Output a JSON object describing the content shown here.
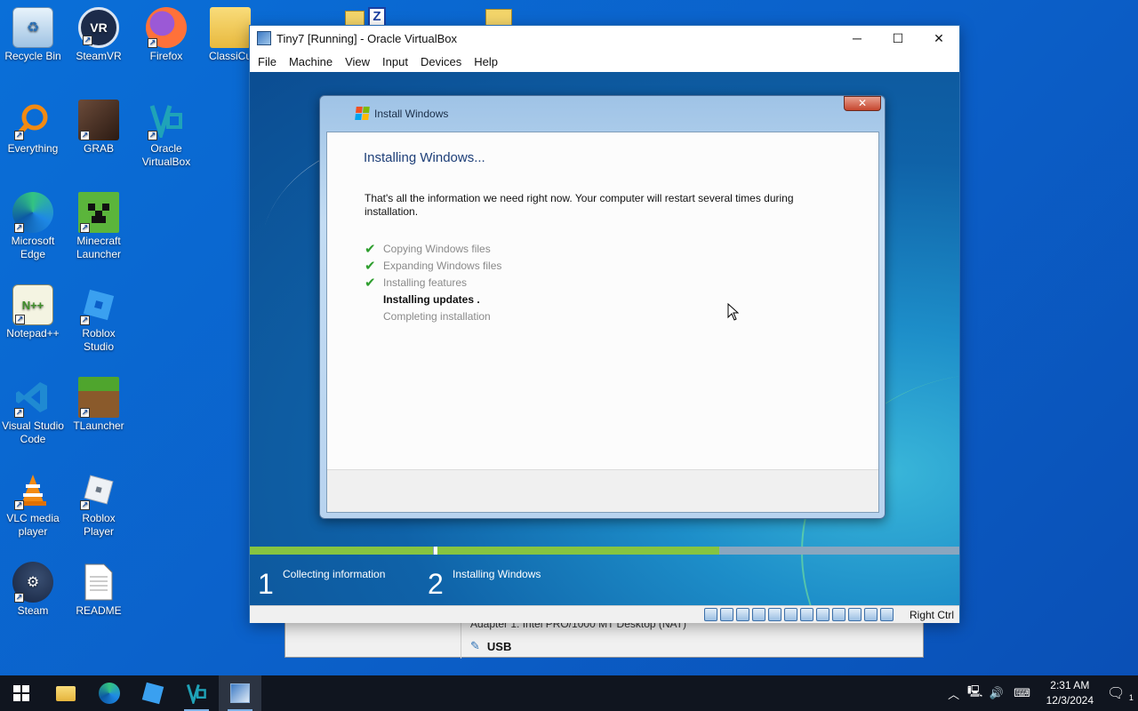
{
  "desktop_icons": [
    {
      "label": "Recycle Bin",
      "icon": "recycle-bin-icon"
    },
    {
      "label": "SteamVR",
      "icon": "steamvr-icon"
    },
    {
      "label": "Firefox",
      "icon": "firefox-icon"
    },
    {
      "label": "ClassiCu",
      "icon": "folder-icon"
    },
    {
      "label": "Everything",
      "icon": "everything-icon"
    },
    {
      "label": "GRAB",
      "icon": "grab-icon"
    },
    {
      "label": "Oracle VirtualBox",
      "icon": "virtualbox-icon"
    },
    {
      "label": "Microsoft Edge",
      "icon": "edge-icon"
    },
    {
      "label": "Minecraft Launcher",
      "icon": "minecraft-icon"
    },
    {
      "label": "Notepad++",
      "icon": "notepad-plus-plus-icon"
    },
    {
      "label": "Roblox Studio",
      "icon": "roblox-studio-icon"
    },
    {
      "label": "Visual Studio Code",
      "icon": "vscode-icon"
    },
    {
      "label": "TLauncher",
      "icon": "tlauncher-icon"
    },
    {
      "label": "VLC media player",
      "icon": "vlc-icon"
    },
    {
      "label": "Roblox Player",
      "icon": "roblox-player-icon"
    },
    {
      "label": "Steam",
      "icon": "steam-icon"
    },
    {
      "label": "README",
      "icon": "text-file-icon"
    }
  ],
  "vbox_window": {
    "title": "Tiny7 [Running] - Oracle VirtualBox",
    "menu": [
      "File",
      "Machine",
      "View",
      "Input",
      "Devices",
      "Help"
    ],
    "host_key": "Right Ctrl"
  },
  "background_window": {
    "adapter_text": "Adapter 1:   Intel PRO/1000 MT Desktop (NAT)",
    "usb_label": "USB"
  },
  "install_dialog": {
    "title": "Install Windows",
    "heading": "Installing Windows...",
    "message": "That's all the information we need right now. Your computer will restart several times during installation.",
    "steps": [
      {
        "label": "Copying Windows files",
        "state": "done"
      },
      {
        "label": "Expanding Windows files",
        "state": "done"
      },
      {
        "label": "Installing features",
        "state": "done"
      },
      {
        "label": "Installing updates .",
        "state": "active"
      },
      {
        "label": "Completing installation",
        "state": "pending"
      }
    ]
  },
  "setup_progress": {
    "phase1_number": "1",
    "phase1_label": "Collecting information",
    "phase2_number": "2",
    "phase2_label": "Installing Windows",
    "phase1_fraction": 1.0,
    "phase2_fraction": 0.54
  },
  "taskbar": {
    "time": "2:31 AM",
    "date": "12/3/2024",
    "notification_count": "1"
  },
  "colors": {
    "desktop": "#0b5fc8",
    "progress_fill": "#86c441",
    "taskbar": "#10151f"
  }
}
